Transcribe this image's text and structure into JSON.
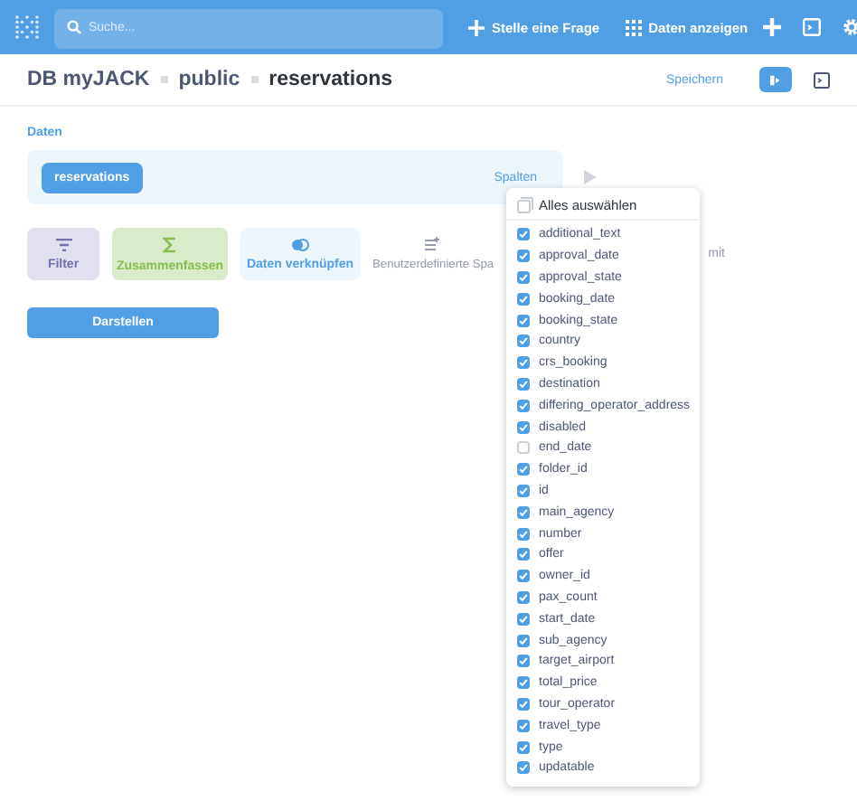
{
  "topbar": {
    "search_placeholder": "Suche...",
    "actions": [
      {
        "kind": "plus",
        "label": "Stelle eine Frage"
      },
      {
        "kind": "grid",
        "label": "Daten anzeigen"
      }
    ]
  },
  "breadcrumb": [
    "DB myJACK",
    "public",
    "reservations"
  ],
  "header_actions": {
    "save": "Speichern"
  },
  "section_label": "Daten",
  "data_box": {
    "table": "reservations",
    "columns_link": "Spalten"
  },
  "steps": [
    {
      "kind": "filter",
      "label": "Filter"
    },
    {
      "kind": "summarize",
      "label": "Zusammenfassen"
    },
    {
      "kind": "join",
      "label": "Daten verknüpfen"
    },
    {
      "kind": "custom",
      "label": "Benutzerdefinierte Spa"
    },
    {
      "kind": "limit",
      "label": "mit"
    }
  ],
  "visualize_button": "Darstellen",
  "columns_menu": {
    "select_all": "Alles auswählen",
    "columns": [
      {
        "name": "additional_text",
        "checked": true
      },
      {
        "name": "approval_date",
        "checked": true
      },
      {
        "name": "approval_state",
        "checked": true
      },
      {
        "name": "booking_date",
        "checked": true
      },
      {
        "name": "booking_state",
        "checked": true
      },
      {
        "name": "country",
        "checked": true
      },
      {
        "name": "crs_booking",
        "checked": true
      },
      {
        "name": "destination",
        "checked": true
      },
      {
        "name": "differing_operator_address",
        "checked": true
      },
      {
        "name": "disabled",
        "checked": true
      },
      {
        "name": "end_date",
        "checked": false
      },
      {
        "name": "folder_id",
        "checked": true
      },
      {
        "name": "id",
        "checked": true
      },
      {
        "name": "main_agency",
        "checked": true
      },
      {
        "name": "number",
        "checked": true
      },
      {
        "name": "offer",
        "checked": true
      },
      {
        "name": "owner_id",
        "checked": true
      },
      {
        "name": "pax_count",
        "checked": true
      },
      {
        "name": "start_date",
        "checked": true
      },
      {
        "name": "sub_agency",
        "checked": true
      },
      {
        "name": "target_airport",
        "checked": true
      },
      {
        "name": "total_price",
        "checked": true
      },
      {
        "name": "tour_operator",
        "checked": true
      },
      {
        "name": "travel_type",
        "checked": true
      },
      {
        "name": "type",
        "checked": true
      },
      {
        "name": "updatable",
        "checked": true
      }
    ]
  }
}
